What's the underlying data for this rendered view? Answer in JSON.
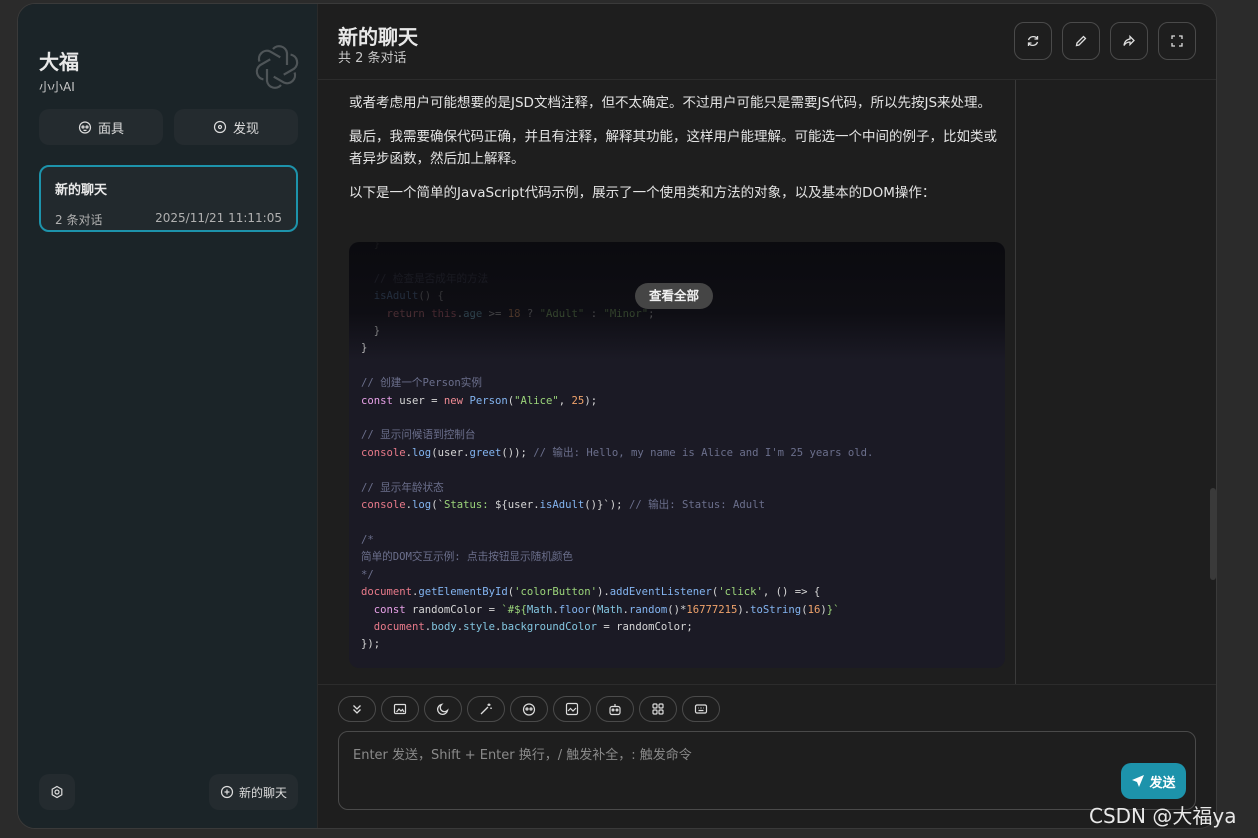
{
  "sidebar": {
    "brand_title": "大福",
    "brand_subtitle": "小小AI",
    "mask_button": "面具",
    "discover_button": "发现",
    "chat": {
      "title": "新的聊天",
      "count": "2 条对话",
      "time": "2025/11/21 11:11:05"
    },
    "new_chat_button": "新的聊天"
  },
  "header": {
    "title": "新的聊天",
    "subtitle": "共 2 条对话"
  },
  "message": {
    "p1": "或者考虑用户可能想要的是JSD文档注释，但不太确定。不过用户可能只是需要JS代码，所以先按JS来处理。",
    "p2": "最后，我需要确保代码正确，并且有注释，解释其功能，这样用户能理解。可能选一个中间的例子，比如类或者异步函数，然后加上解释。",
    "p3": "以下是一个简单的JavaScript代码示例，展示了一个使用类和方法的对象，以及基本的DOM操作：",
    "view_all": "查看全部"
  },
  "composer": {
    "placeholder": "Enter 发送，Shift + Enter 换行，/ 触发补全，: 触发命令",
    "send_label": "发送"
  },
  "watermark": "CSDN @大福ya",
  "colors": {
    "accent": "#1d93ab",
    "sidebar_bg": "#1b2428",
    "main_bg": "#1e1e1e"
  },
  "icons": [
    "openai-logo-icon",
    "mask-icon",
    "compass-icon",
    "settings-icon",
    "plus-circle-icon",
    "refresh-icon",
    "edit-icon",
    "share-icon",
    "fullscreen-icon",
    "collapse-icon",
    "image-icon",
    "moon-icon",
    "magic-icon",
    "mask-icon",
    "image-frame-icon",
    "robot-icon",
    "grid-icon",
    "keyboard-icon",
    "send-icon"
  ]
}
